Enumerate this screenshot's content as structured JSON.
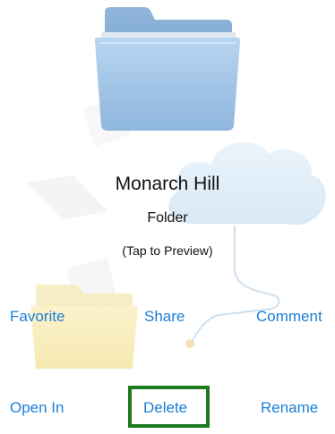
{
  "item": {
    "name": "Monarch Hill",
    "kind": "Folder",
    "hint": "(Tap to Preview)"
  },
  "actions": {
    "favorite": "Favorite",
    "share": "Share",
    "comment": "Comment",
    "open_in": "Open In",
    "delete": "Delete",
    "rename": "Rename"
  },
  "icons": {
    "main": "folder-icon",
    "background": [
      "paper-sheet-icon",
      "cloud-icon",
      "yellow-folder-icon"
    ]
  },
  "colors": {
    "action_text": "#1a7fd6",
    "highlight": "#1e7a1e",
    "folder_blue": "#9cc3e8"
  }
}
